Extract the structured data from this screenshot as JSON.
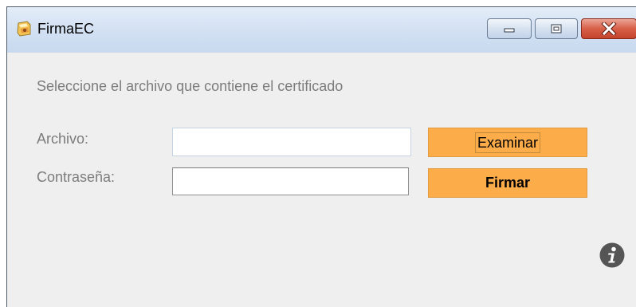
{
  "window": {
    "title": "FirmaEC",
    "app_icon": "app-icon",
    "controls": {
      "minimize_icon": "minimize-icon",
      "maximize_icon": "maximize-icon",
      "close_icon": "close-icon"
    }
  },
  "form": {
    "instructions": "Seleccione el archivo que contiene el certificado",
    "archivo_label": "Archivo:",
    "archivo_value": "",
    "contrasena_label": "Contraseña:",
    "contrasena_value": "",
    "examinar_label": "Examinar",
    "firmar_label": "Firmar"
  },
  "footer": {
    "info_icon": "info-icon"
  },
  "colors": {
    "button_orange": "#fdac4a",
    "label_gray": "#7c7c7c",
    "window_bg": "#efefef",
    "close_red": "#d85f48"
  }
}
